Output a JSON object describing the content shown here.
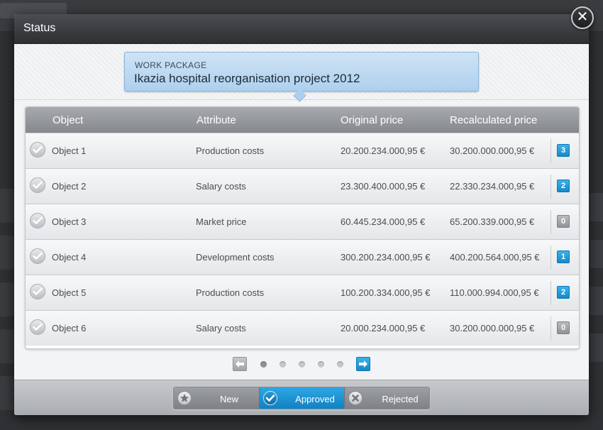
{
  "modal": {
    "title": "Status",
    "close_symbol": "✕"
  },
  "work_package": {
    "label": "WORK PACKAGE",
    "name": "Ikazia hospital reorganisation project 2012"
  },
  "table": {
    "columns": [
      "Object",
      "Attribute",
      "Original price",
      "Recalculated price"
    ],
    "rows": [
      {
        "object": "Object 1",
        "attribute": "Production costs",
        "original": "20.200.234.000,95 €",
        "recalculated": "30.200.000.000,95 €",
        "count": "3",
        "count_style": "blue"
      },
      {
        "object": "Object 2",
        "attribute": "Salary costs",
        "original": "23.300.400.000,95 €",
        "recalculated": "22.330.234.000,95 €",
        "count": "2",
        "count_style": "blue"
      },
      {
        "object": "Object 3",
        "attribute": "Market price",
        "original": "60.445.234.000,95 €",
        "recalculated": "65.200.339.000,95 €",
        "count": "0",
        "count_style": "gray"
      },
      {
        "object": "Object 4",
        "attribute": "Development costs",
        "original": "300.200.234.000,95 €",
        "recalculated": "400.200.564.000,95 €",
        "count": "1",
        "count_style": "blue"
      },
      {
        "object": "Object 5",
        "attribute": "Production costs",
        "original": "100.200.334.000,95 €",
        "recalculated": "110.000.994.000,95 €",
        "count": "2",
        "count_style": "blue"
      },
      {
        "object": "Object 6",
        "attribute": "Salary costs",
        "original": "20.000.234.000,95 €",
        "recalculated": "30.200.000.000,95 €",
        "count": "0",
        "count_style": "gray"
      }
    ]
  },
  "pagination": {
    "prev_icon": "arrow-left-icon",
    "next_icon": "arrow-right-icon",
    "pages": 5,
    "active_page": 1
  },
  "status_filter": {
    "options": [
      {
        "label": "New",
        "icon": "star-icon",
        "active": false
      },
      {
        "label": "Approved",
        "icon": "check-icon",
        "active": true
      },
      {
        "label": "Rejected",
        "icon": "x-icon",
        "active": false
      }
    ]
  },
  "colors": {
    "accent": "#1a8fd0",
    "header_bar": "#2e3033",
    "badge_gray": "#8f9296"
  }
}
